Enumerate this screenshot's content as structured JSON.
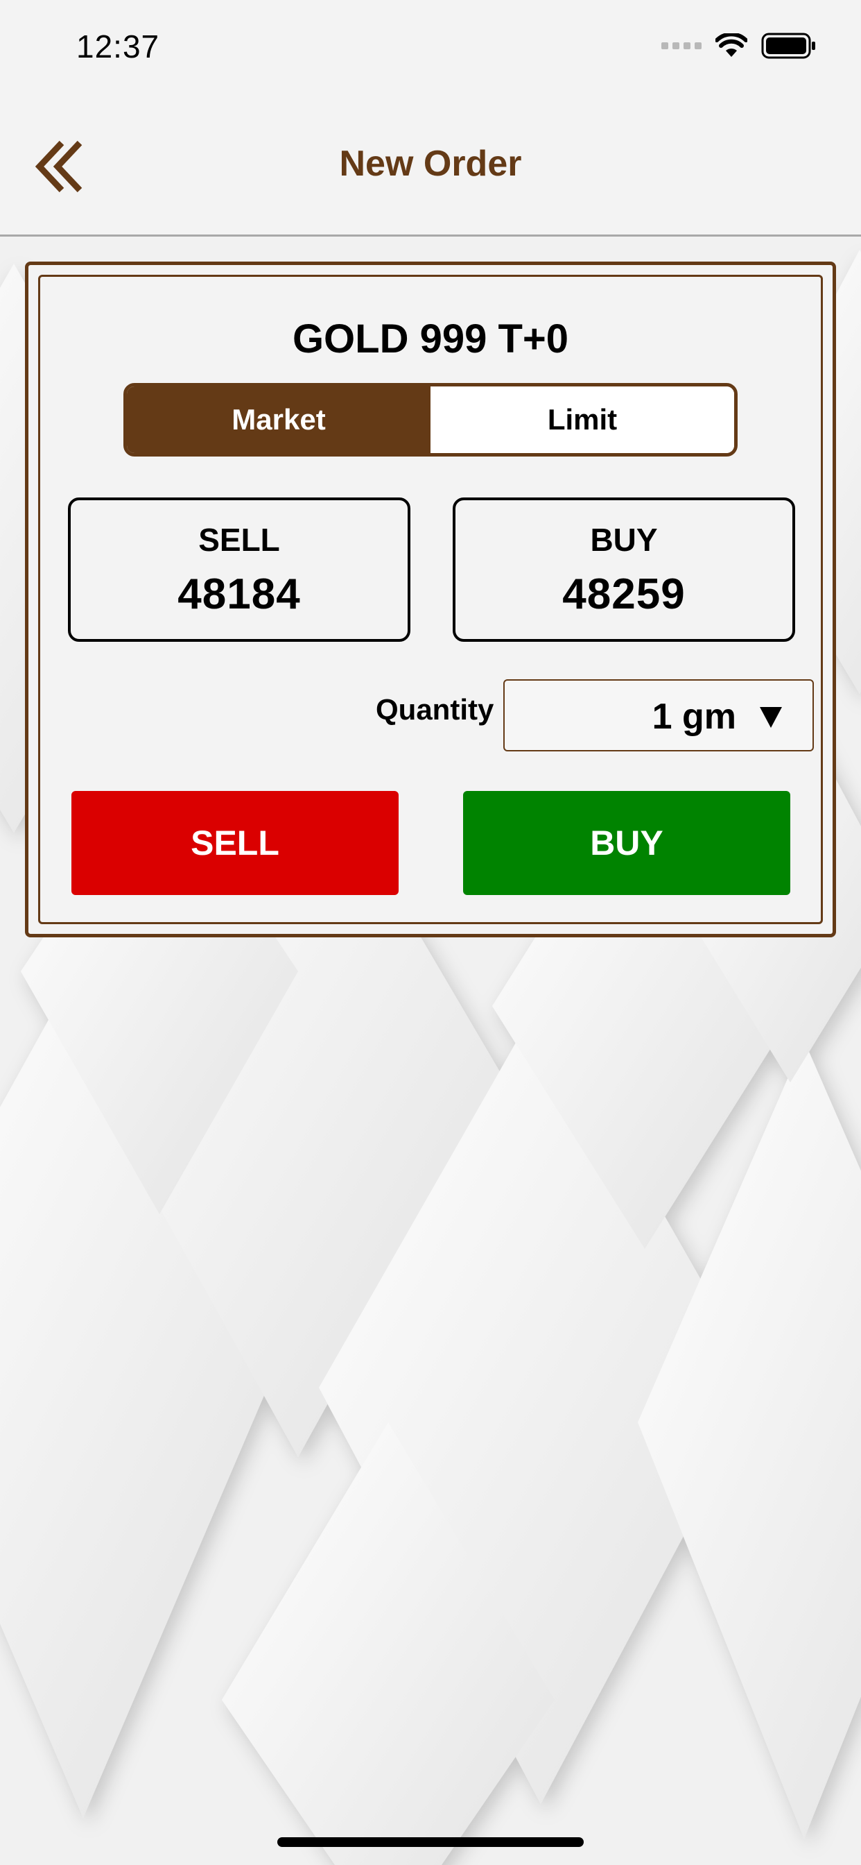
{
  "status_bar": {
    "time": "12:37",
    "icons": [
      "signal-icon",
      "wifi-icon",
      "battery-icon"
    ]
  },
  "nav": {
    "title": "New Order",
    "back_icon": "double-chevron-left-icon"
  },
  "order": {
    "symbol": "GOLD 999 T+0",
    "tabs": [
      {
        "label": "Market",
        "active": true
      },
      {
        "label": "Limit",
        "active": false
      }
    ],
    "sell_price": {
      "label": "SELL",
      "value": "48184"
    },
    "buy_price": {
      "label": "BUY",
      "value": "48259"
    },
    "quantity": {
      "label": "Quantity :",
      "value": "1 gm"
    },
    "sell_button": "SELL",
    "buy_button": "BUY"
  },
  "colors": {
    "brand_brown": "#643a16",
    "sell_red": "#da0000",
    "buy_green": "#008300",
    "background": "#f3f3f3"
  }
}
